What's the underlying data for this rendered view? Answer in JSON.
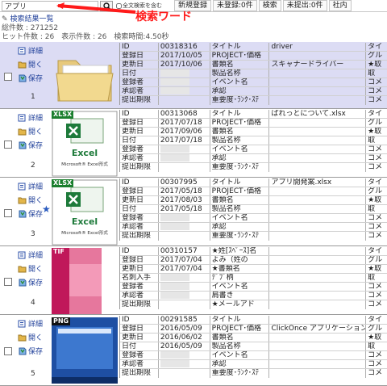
{
  "search": {
    "value": "アプリ",
    "fulltext_label": "全文検索を含む",
    "keyword_label": "検索ワード"
  },
  "top_buttons": [
    "新規登録",
    "未登録:0件",
    "検索",
    "未提出:0件",
    "社内"
  ],
  "results_title": "検索結果一覧",
  "meta": {
    "total": "総件数 : 271252",
    "stats": "ヒット件数 : 26　表示件数 : 26　検索時間:4.50秒"
  },
  "actions": {
    "detail": "詳細",
    "open": "開く",
    "save": "保存"
  },
  "results": [
    {
      "num": "1",
      "thumb": "folder",
      "badge": "",
      "rows": [
        [
          "ID",
          "00318316",
          "タイトル",
          "driver",
          "タイ"
        ],
        [
          "登録日",
          "2017/10/05",
          "PROJECT･価格",
          "",
          "グル"
        ],
        [
          "更新日",
          "2017/10/06",
          "書類名",
          "スキャナードライバー",
          "★取"
        ],
        [
          "日付",
          "",
          "製品名称",
          "",
          "取"
        ],
        [
          "登録者",
          "",
          "イベント名",
          "",
          "コメ"
        ],
        [
          "承認者",
          "",
          "承認",
          "",
          "コメ"
        ],
        [
          "提出期限",
          "",
          "重要度･ﾗﾝｸ･ｽﾃ",
          "",
          "コメ"
        ]
      ]
    },
    {
      "num": "2",
      "thumb": "excel",
      "badge": "XLSX",
      "rows": [
        [
          "ID",
          "00313068",
          "タイトル",
          "ぱれっとについて.xlsx",
          "タイ"
        ],
        [
          "登録日",
          "2017/07/18",
          "PROJECT･価格",
          "",
          "グル"
        ],
        [
          "更新日",
          "2017/09/06",
          "書類名",
          "",
          "★取"
        ],
        [
          "日付",
          "2017/07/18",
          "製品名称",
          "",
          "取"
        ],
        [
          "登録者",
          "",
          "イベント名",
          "",
          "コメ"
        ],
        [
          "承認者",
          "",
          "承認",
          "",
          "コメ"
        ],
        [
          "提出期限",
          "",
          "重要度･ﾗﾝｸ･ｽﾃ",
          "",
          "コメ"
        ]
      ]
    },
    {
      "num": "3",
      "thumb": "excel",
      "badge": "XLSX",
      "rows": [
        [
          "ID",
          "00307995",
          "タイトル",
          "アプリ開発案.xlsx",
          "タイ"
        ],
        [
          "登録日",
          "2017/05/18",
          "PROJECT･価格",
          "",
          "グル"
        ],
        [
          "更新日",
          "2017/08/03",
          "書類名",
          "",
          "★取"
        ],
        [
          "日付",
          "2017/05/18",
          "製品名称",
          "",
          "取"
        ],
        [
          "登録者",
          "",
          "イベント名",
          "",
          "コメ"
        ],
        [
          "承認者",
          "",
          "承認",
          "",
          "コメ"
        ],
        [
          "提出期限",
          "",
          "重要度･ﾗﾝｸ･ｽﾃ",
          "",
          "コメ"
        ]
      ]
    },
    {
      "num": "4",
      "thumb": "tif",
      "badge": "TIF",
      "rows": [
        [
          "ID",
          "00310157",
          "★姓[ｽﾍﾟｰｽ]名",
          "",
          "タイ"
        ],
        [
          "登録日",
          "2017/07/04",
          "よみ（姓の",
          "",
          "グル"
        ],
        [
          "更新日",
          "2017/07/04",
          "★書類名",
          "",
          "★取"
        ],
        [
          "名刺入手",
          "",
          "ﾃﾞﾌﾞ柄",
          "",
          "取"
        ],
        [
          "登録者",
          "",
          "イベント名",
          "",
          "コメ"
        ],
        [
          "承認者",
          "",
          "肩書き",
          "",
          "コメ"
        ],
        [
          "提出期限",
          "",
          "★メールアド",
          "",
          "コメ"
        ]
      ]
    },
    {
      "num": "5",
      "thumb": "png",
      "badge": "PNG",
      "rows": [
        [
          "ID",
          "00291585",
          "タイトル",
          "",
          "タイ"
        ],
        [
          "登録日",
          "2016/05/09",
          "PROJECT･価格",
          "ClickOnce アプリケーションの",
          "グル"
        ],
        [
          "更新日",
          "2016/06/02",
          "書類名",
          "",
          "★取"
        ],
        [
          "日付",
          "2016/05/09",
          "製品名称",
          "",
          "取"
        ],
        [
          "登録者",
          "",
          "イベント名",
          "",
          "コメ"
        ],
        [
          "承認者",
          "",
          "承認",
          "",
          "コメ"
        ],
        [
          "提出期限",
          "",
          "重要度･ﾗﾝｸ･ｽﾃ",
          "",
          "コメ"
        ]
      ]
    }
  ],
  "excel_thumb": {
    "title": "Excel",
    "subtitle": "Microsoft® Excel形式"
  },
  "colors": {
    "accent": "#1f3f99",
    "keyword": "#ff1a1a",
    "highlight": "#dcdcf4",
    "badge": "#1b7f2e"
  }
}
